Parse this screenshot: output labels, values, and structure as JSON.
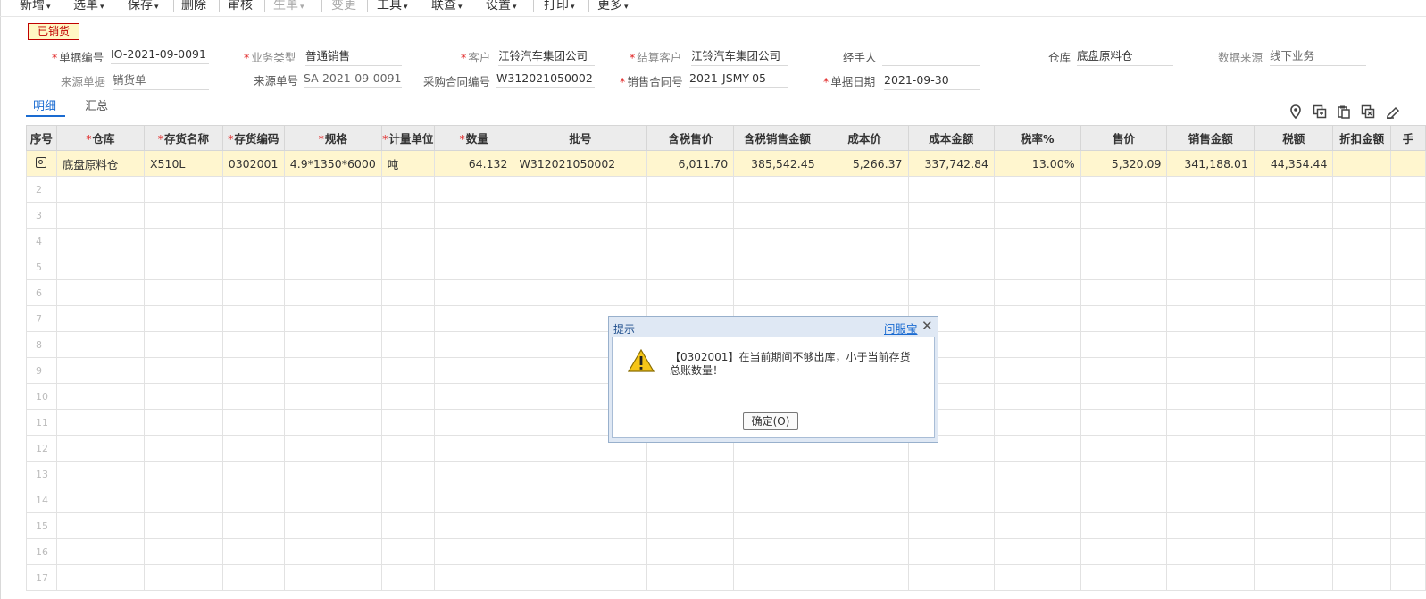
{
  "toolbar": {
    "items": [
      {
        "label": "新增",
        "chevron": true,
        "disabled": false
      },
      {
        "label": "选单",
        "chevron": true,
        "disabled": false
      },
      {
        "label": "保存",
        "chevron": true,
        "disabled": false
      },
      {
        "label": "删除",
        "chevron": false,
        "disabled": false
      },
      {
        "label": "审核",
        "chevron": false,
        "disabled": false
      },
      {
        "label": "生单",
        "chevron": true,
        "disabled": true
      },
      {
        "label": "变更",
        "chevron": false,
        "disabled": true
      },
      {
        "label": "工具",
        "chevron": true,
        "disabled": false
      },
      {
        "label": "联查",
        "chevron": true,
        "disabled": false
      },
      {
        "label": "设置",
        "chevron": true,
        "disabled": false
      },
      {
        "label": "打印",
        "chevron": true,
        "disabled": false
      },
      {
        "label": "更多",
        "chevron": true,
        "disabled": false
      }
    ]
  },
  "status_badge": "已销货",
  "form": {
    "doc_no_label": "单据编号",
    "doc_no": "IO-2021-09-0091",
    "biz_type_label": "业务类型",
    "biz_type": "普通销售",
    "customer_label": "客户",
    "customer": "江铃汽车集团公司",
    "settle_customer_label": "结算客户",
    "settle_customer": "江铃汽车集团公司",
    "handler_label": "经手人",
    "handler": "",
    "warehouse_label": "仓库",
    "warehouse": "底盘原料仓",
    "data_source_label": "数据来源",
    "data_source": "线下业务",
    "source_doc_label": "来源单据",
    "source_doc": "销货单",
    "source_no_label": "来源单号",
    "source_no": "SA-2021-09-0091",
    "po_no_label": "采购合同编号",
    "po_no": "W312021050002",
    "sales_contract_label": "销售合同号",
    "sales_contract": "2021-JSMY-05",
    "doc_date_label": "单据日期",
    "doc_date": "2021-09-30"
  },
  "tabs": {
    "detail": "明细",
    "summary": "汇总"
  },
  "grid": {
    "columns": [
      {
        "label": "序号",
        "req": false
      },
      {
        "label": "仓库",
        "req": true
      },
      {
        "label": "存货名称",
        "req": true
      },
      {
        "label": "存货编码",
        "req": true
      },
      {
        "label": "规格",
        "req": true
      },
      {
        "label": "计量单位",
        "req": true
      },
      {
        "label": "数量",
        "req": true
      },
      {
        "label": "批号",
        "req": false
      },
      {
        "label": "含税售价",
        "req": false
      },
      {
        "label": "含税销售金额",
        "req": false
      },
      {
        "label": "成本价",
        "req": false
      },
      {
        "label": "成本金额",
        "req": false
      },
      {
        "label": "税率%",
        "req": false
      },
      {
        "label": "售价",
        "req": false
      },
      {
        "label": "销售金额",
        "req": false
      },
      {
        "label": "税额",
        "req": false
      },
      {
        "label": "折扣金额",
        "req": false
      },
      {
        "label": "手",
        "req": false
      }
    ],
    "row1": {
      "warehouse": "底盘原料仓",
      "item_name": "X510L",
      "item_code": "0302001",
      "spec": "4.9*1350*6000",
      "unit": "吨",
      "qty": "64.132",
      "batch": "W312021050002",
      "tax_price": "6,011.70",
      "tax_amount": "385,542.45",
      "cost_price": "5,266.37",
      "cost_amount": "337,742.84",
      "tax_rate": "13.00%",
      "price": "5,320.09",
      "amount": "341,188.01",
      "tax": "44,354.44",
      "discount": ""
    },
    "empty_rows": [
      "2",
      "3",
      "4",
      "5",
      "6",
      "7",
      "8",
      "9",
      "10",
      "11",
      "12",
      "13",
      "14",
      "15",
      "16",
      "17"
    ]
  },
  "dialog": {
    "title": "提示",
    "help_link": "问服宝",
    "message": "【0302001】在当前期间不够出库，小于当前存货总账数量！",
    "ok_label": "确定(O)"
  },
  "colors": {
    "accent": "#1a6bd1",
    "required": "#e02020",
    "status_border": "#c00000",
    "status_bg": "#fff7c4",
    "row_highlight": "#fff6cf"
  }
}
